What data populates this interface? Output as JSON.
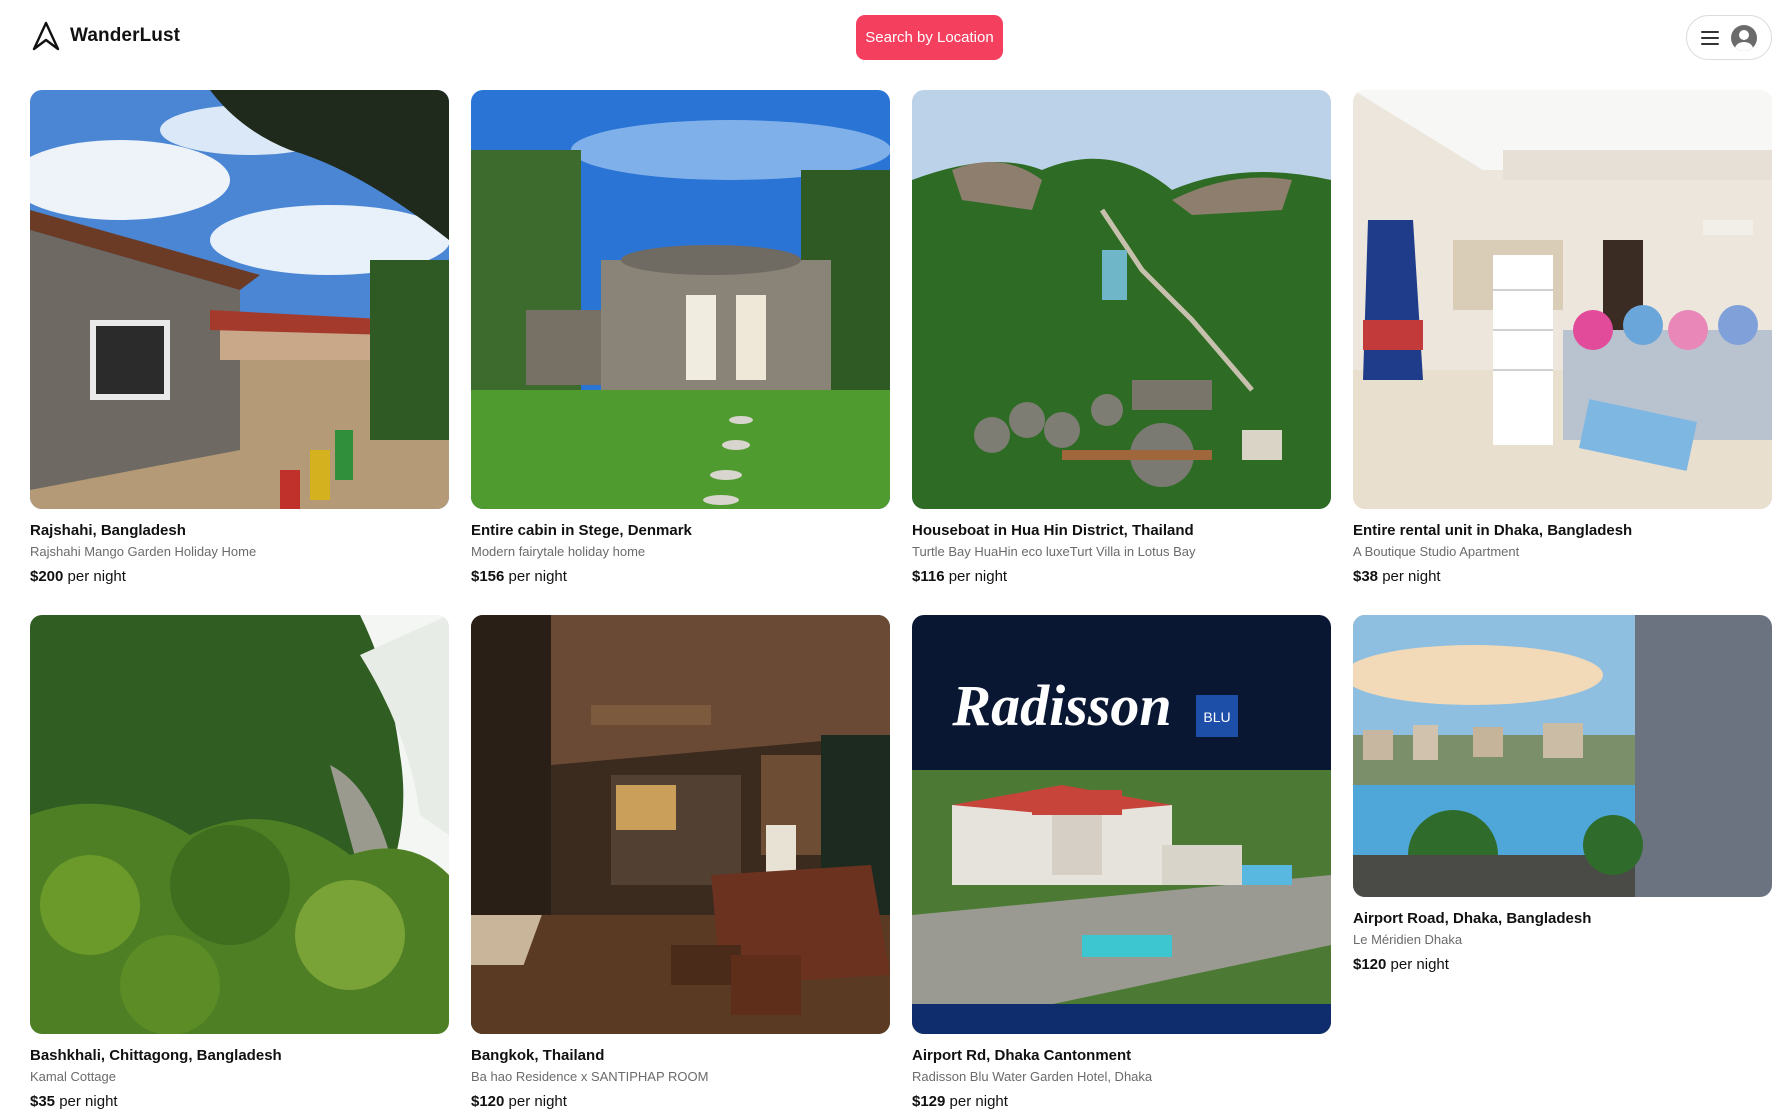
{
  "app": {
    "name": "WanderLust",
    "logo_icon": "airbnb-style-logo-icon"
  },
  "header": {
    "search_label": "Search by Location",
    "accent": "#f43f5e",
    "menu_icon": "hamburger-icon",
    "avatar_icon": "user-avatar-icon"
  },
  "price_suffix": "per night",
  "listings": [
    {
      "location": "Rajshahi, Bangladesh",
      "title": "Rajshahi Mango Garden Holiday Home",
      "price": "$200"
    },
    {
      "location": "Entire cabin in Stege, Denmark",
      "title": "Modern fairytale holiday home",
      "price": "$156"
    },
    {
      "location": "Houseboat in Hua Hin District, Thailand",
      "title": "Turtle Bay HuaHin eco luxeTurt Villa in Lotus Bay",
      "price": "$116"
    },
    {
      "location": "Entire rental unit in Dhaka, Bangladesh",
      "title": "A Boutique Studio Apartment",
      "price": "$38"
    },
    {
      "location": "Bashkhali, Chittagong, Bangladesh",
      "title": "Kamal Cottage",
      "price": "$35"
    },
    {
      "location": "Bangkok, Thailand",
      "title": "Ba hao Residence x SANTIPHAP ROOM",
      "price": "$120"
    },
    {
      "location": "Airport Rd, Dhaka Cantonment",
      "title": "Radisson Blu Water Garden Hotel, Dhaka",
      "price": "$129",
      "image_logo": "Radisson BLU"
    },
    {
      "location": "Airport Road, Dhaka, Bangladesh",
      "title": "Le Méridien Dhaka",
      "price": "$120"
    }
  ]
}
